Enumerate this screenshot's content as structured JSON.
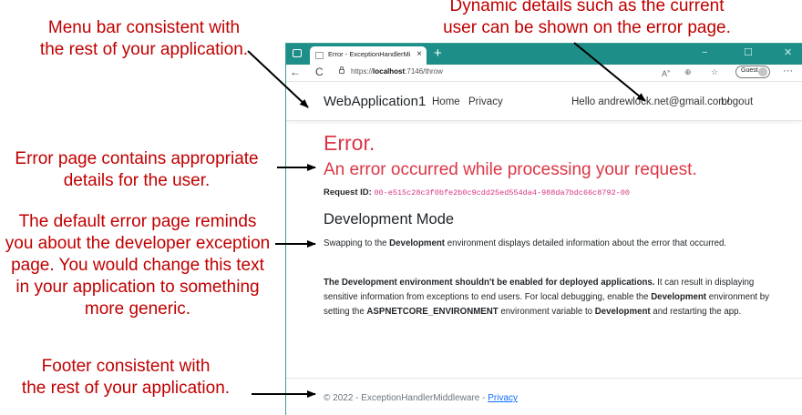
{
  "annotations": {
    "menu": [
      "Menu bar consistent with",
      "the rest of your application."
    ],
    "dynamic": [
      "Dynamic details such as the current",
      "user can be shown on the error page."
    ],
    "error": [
      "Error page contains appropriate",
      "details for the user."
    ],
    "default": [
      "The default error page reminds",
      "you about the developer exception",
      "page. You would change this text",
      "in your application to something",
      "more generic."
    ],
    "footer": [
      "Footer consistent with",
      "the rest of your application."
    ]
  },
  "colors": {
    "annotation": "#c00000",
    "titlebar": "#1e8f88",
    "error": "#dc3545",
    "code": "#d63384",
    "link": "#0d6efd"
  },
  "browser": {
    "tab_title": "Error - ExceptionHandlerMiddlew",
    "tab_close": "×",
    "new_tab": "+",
    "minimize": "−",
    "maximize": "☐",
    "close": "✕",
    "back": "←",
    "refresh": "C",
    "url_prefix": "https://",
    "url_host": "localhost",
    "url_rest": ":7146/throw",
    "guest": "Guest",
    "more": "···"
  },
  "nav": {
    "brand": "WebApplication1",
    "home": "Home",
    "privacy": "Privacy",
    "hello": "Hello andrewlock.net@gmail.com!",
    "logout": "Logout"
  },
  "page": {
    "error_title": "Error.",
    "error_subtitle": "An error occurred while processing your request.",
    "request_id_label": "Request ID:",
    "request_id": "00-e515c28c3f0bfe2b0c9cdd25ed554da4-988da7bdc66c8792-00",
    "dev_heading": "Development Mode",
    "para1": {
      "t1": "Swapping to the ",
      "b1": "Development",
      "t2": " environment displays detailed information about the error that occurred."
    },
    "para2": {
      "b1": "The Development environment shouldn't be enabled for deployed applications.",
      "t1": " It can result in displaying sensitive information from exceptions to end users. For local debugging, enable the ",
      "b2": "Development",
      "t2": " environment by setting the ",
      "b3": "ASPNETCORE_ENVIRONMENT",
      "t3": " environment variable to ",
      "b4": "Development",
      "t4": " and restarting the app."
    }
  },
  "footer": {
    "text": "© 2022 - ExceptionHandlerMiddleware - ",
    "link": "Privacy"
  }
}
